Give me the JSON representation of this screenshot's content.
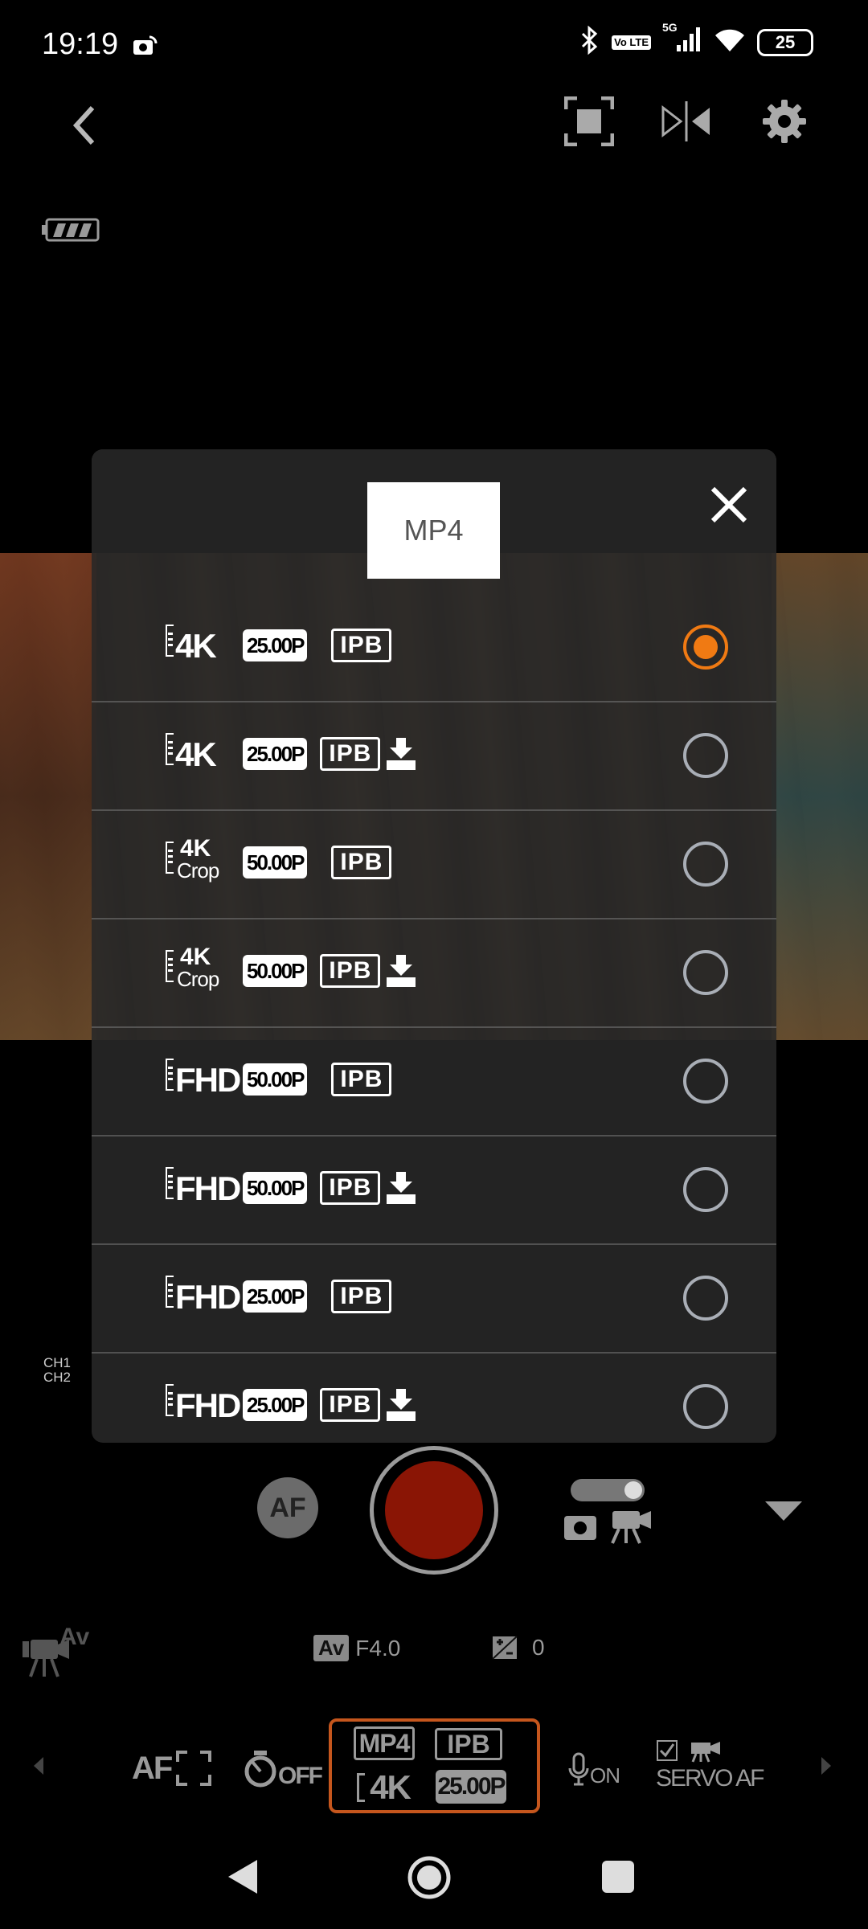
{
  "status": {
    "time": "19:19",
    "battery": "25",
    "network": "5G",
    "volte": "Vo LTE"
  },
  "toolbar": {
    "back_icon": "chevron-left-icon",
    "icons": [
      "fullscreen-icon",
      "flip-icon",
      "gear-icon"
    ]
  },
  "modal": {
    "tab": "MP4",
    "close_icon": "close-icon",
    "options": [
      {
        "res": "4K",
        "crop": "",
        "fps": "25.00P",
        "codec": "IPB",
        "lite": false,
        "selected": true
      },
      {
        "res": "4K",
        "crop": "",
        "fps": "25.00P",
        "codec": "IPB",
        "lite": true,
        "selected": false
      },
      {
        "res": "4K",
        "crop": "Crop",
        "fps": "50.00P",
        "codec": "IPB",
        "lite": false,
        "selected": false
      },
      {
        "res": "4K",
        "crop": "Crop",
        "fps": "50.00P",
        "codec": "IPB",
        "lite": true,
        "selected": false
      },
      {
        "res": "FHD",
        "crop": "",
        "fps": "50.00P",
        "codec": "IPB",
        "lite": false,
        "selected": false
      },
      {
        "res": "FHD",
        "crop": "",
        "fps": "50.00P",
        "codec": "IPB",
        "lite": true,
        "selected": false
      },
      {
        "res": "FHD",
        "crop": "",
        "fps": "25.00P",
        "codec": "IPB",
        "lite": false,
        "selected": false
      },
      {
        "res": "FHD",
        "crop": "",
        "fps": "25.00P",
        "codec": "IPB",
        "lite": true,
        "selected": false
      }
    ]
  },
  "audio": {
    "ch1": "CH1",
    "ch2": "CH2"
  },
  "capture": {
    "af_label": "AF",
    "mode_icon": "photo-video-toggle-icon",
    "more_icon": "triangle-down-icon"
  },
  "exposure": {
    "mode_badge": "Av",
    "aperture": "F4.0",
    "ev_value": "0",
    "mode_icon_label": "Av"
  },
  "bottom": {
    "af_label": "AF",
    "timer_label": "OFF",
    "quality": {
      "format": "MP4",
      "codec": "IPB",
      "res": "4K",
      "fps": "25.00P"
    },
    "mic_label": "ON",
    "servo_label": "SERVO AF"
  },
  "colors": {
    "accent": "#f07a13",
    "record": "#8a1505",
    "highlight_box": "#c5561d"
  }
}
